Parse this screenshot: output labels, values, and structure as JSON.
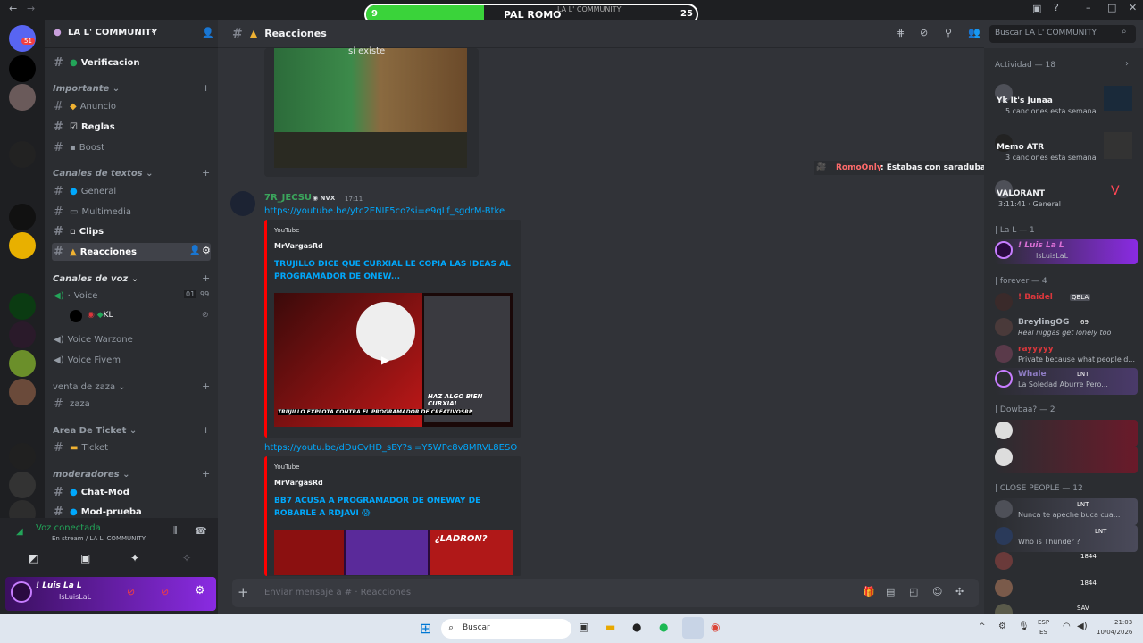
{
  "banner": {
    "left_count": "9",
    "title": "PAL ROMO",
    "right_count": "25",
    "overlay_text": "LA L' COMMUNITY"
  },
  "server": {
    "name": "LA L' COMMUNITY",
    "notif": "51"
  },
  "channels": {
    "verificacion": "Verificacion",
    "sec_importante": "Importante",
    "anuncio": "Anuncio",
    "reglas": "Reglas",
    "boost": "Boost",
    "sec_textos": "Canales de textos",
    "general": "General",
    "multimedia": "Multimedia",
    "clips": "Clips",
    "reacciones": "Reacciones",
    "sec_voz": "Canales de voz",
    "voice": "Voice",
    "voice_count1": "01",
    "voice_count2": "99",
    "voice_user": "KL",
    "voice_warzone": "Voice Warzone",
    "voice_fivem": "Voice Fivem",
    "sec_venta": "venta de zaza",
    "zaza": "zaza",
    "sec_ticket": "Area De Ticket",
    "ticket": "Ticket",
    "sec_mods": "moderadores",
    "chatmod": "Chat-Mod",
    "modprueba": "Mod-prueba"
  },
  "voice_status": {
    "title": "Voz conectada",
    "sub": "En stream / LA L' COMMUNITY"
  },
  "user": {
    "name": "! Luis La L",
    "tag": "IsLuisLaL"
  },
  "chat": {
    "channel": "Reacciones",
    "image_caption": "si existe",
    "author": "7R_JECSU",
    "badge": "NVX",
    "time": "17:11",
    "link1": "https://youtube.be/ytc2ENIF5co?si=e9qLf_sgdrM-Btke",
    "embed1_provider": "YouTube",
    "embed1_author": "MrVargasRd",
    "embed1_title": "TRUJILLO DICE QUE CURXIAL LE COPIA LAS IDEAS AL PROGRAMADOR DE ONEW...",
    "thumb1_caption": "TRUJILLO EXPLOTA CONTRA EL PROGRAMADOR DE CREATIVOSRP",
    "thumb1_side": "HAZ ALGO BIEN CURXIAL",
    "link2": "https://youtu.be/dDuCvHD_sBY?si=Y5WPc8v8MRVL8ESO",
    "embed2_provider": "YouTube",
    "embed2_author": "MrVargasRd",
    "embed2_title": "BB7 ACUSA A PROGRAMADOR DE ONEWAY DE ROBARLE A RDJAVI 😱",
    "thumb2_caption": "¿LADRON?",
    "placeholder": "Enviar mensaje a #  · Reacciones",
    "toast_name": "RomoOnly",
    "toast_text": ": Estabas con saradubai"
  },
  "search": {
    "placeholder": "Buscar LA L' COMMUNITY"
  },
  "members": {
    "activity": "Actividad — 18",
    "items": [
      {
        "name": "Yk It's Junaa",
        "status": "5 canciones esta semana"
      },
      {
        "name": "Memo ATR",
        "status": "3 canciones esta semana"
      },
      {
        "name": "VALORANT",
        "status": "3:11:41 · General"
      }
    ],
    "group1": "| La L — 1",
    "g1_items": [
      {
        "name": "! Luis La L",
        "status": "IsLuisLaL"
      }
    ],
    "group2": "| forever — 4",
    "g2_items": [
      {
        "name": "! Baidel",
        "status": "",
        "badge": "QBLA"
      },
      {
        "name": "BreylingOG",
        "status": "Real niggas get lonely too",
        "badge": "69"
      },
      {
        "name": "rayyyyy",
        "status": "Private because what people d..."
      },
      {
        "name": "Whale",
        "status": "La Soledad Aburre Pero...",
        "badge": "LNT"
      }
    ],
    "group3": "| Dowbaa? — 2",
    "group4": "| CLOSE PEOPLE — 12",
    "g4_items": [
      {
        "name": "",
        "status": "Nunca te apeche buca cua...",
        "badge": "LNT"
      },
      {
        "name": "",
        "status": "Who is Thunder ?",
        "badge": "LNT"
      },
      {
        "name": "",
        "status": "",
        "badge": "1844"
      },
      {
        "name": "",
        "status": "",
        "badge": "1844"
      },
      {
        "name": "",
        "status": "",
        "badge": "SAV"
      }
    ]
  },
  "taskbar": {
    "search": "Buscar",
    "lang1": "ESP",
    "lang2": "ES",
    "time": "21:03",
    "date": "10/04/2026"
  },
  "colors": {
    "accent": "#5865f2",
    "green": "#23a559",
    "link": "#00a8fc",
    "embed_bar": "#ff0000"
  }
}
